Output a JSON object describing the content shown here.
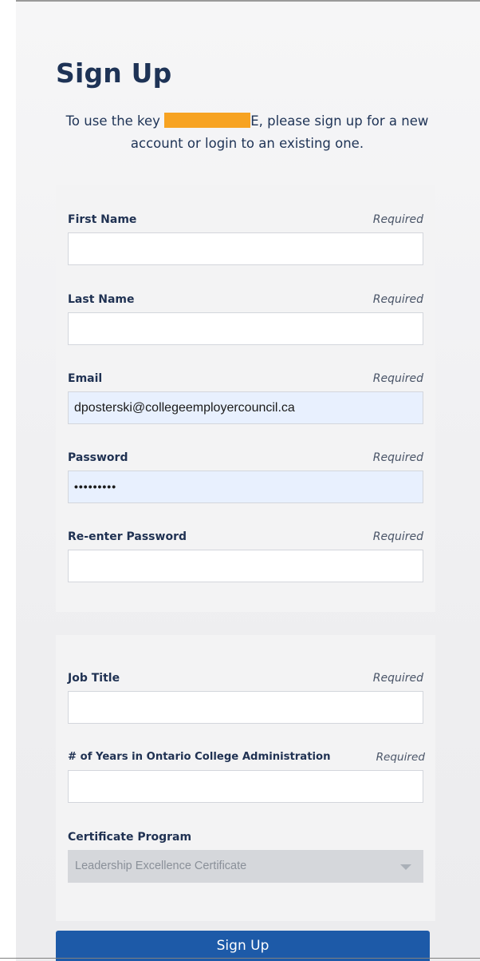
{
  "page": {
    "title": "Sign Up",
    "intro_before": "To use the key ",
    "intro_after": "E, please sign up for a new account or login to an existing one."
  },
  "form": {
    "required_text": "Required",
    "first_name": {
      "label": "First Name",
      "value": "",
      "placeholder": ""
    },
    "last_name": {
      "label": "Last Name",
      "value": "",
      "placeholder": ""
    },
    "email": {
      "label": "Email",
      "value": "dposterski@collegeemployercouncil.ca"
    },
    "password": {
      "label": "Password",
      "value": "•••••••••"
    },
    "reenter_password": {
      "label": "Re-enter Password",
      "value": ""
    },
    "job_title": {
      "label": "Job Title",
      "value": ""
    },
    "years": {
      "label": "# of Years in Ontario College Administration",
      "value": ""
    },
    "certificate_program": {
      "label": "Certificate Program",
      "selected": "Leadership Excellence Certificate"
    }
  },
  "submit": {
    "label": "Sign Up"
  },
  "colors": {
    "primary": "#1d5aa8",
    "heading": "#1e3356",
    "redaction": "#f7a322",
    "autofill": "#e8f0fe",
    "disabled_select": "#d5d7db"
  }
}
